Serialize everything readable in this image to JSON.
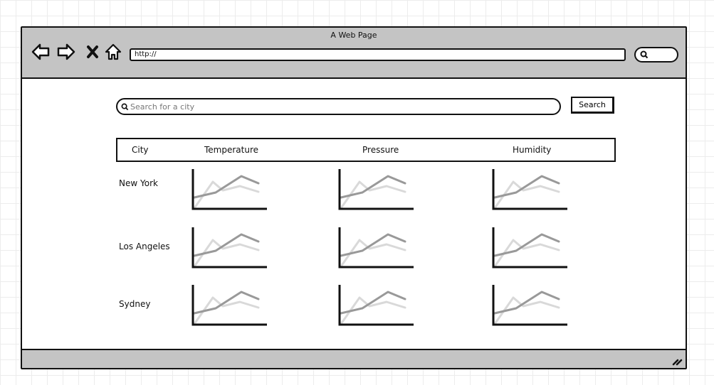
{
  "window": {
    "title": "A Web Page",
    "address": "http://",
    "nav_icons": [
      "back-arrow-icon",
      "forward-arrow-icon",
      "close-x-icon",
      "home-icon"
    ]
  },
  "search": {
    "placeholder": "Search for a city",
    "value": "",
    "button_label": "Search"
  },
  "table": {
    "headers": {
      "city": "City",
      "temperature": "Temperature",
      "pressure": "Pressure",
      "humidity": "Humidity"
    },
    "rows": [
      {
        "city": "New York"
      },
      {
        "city": "Los Angeles"
      },
      {
        "city": "Sydney"
      }
    ],
    "chart_icon": "line-chart-placeholder-icon"
  },
  "colors": {
    "chrome": "#c4c4c4",
    "line_dark": "#999999",
    "line_light": "#d9d9d9"
  }
}
